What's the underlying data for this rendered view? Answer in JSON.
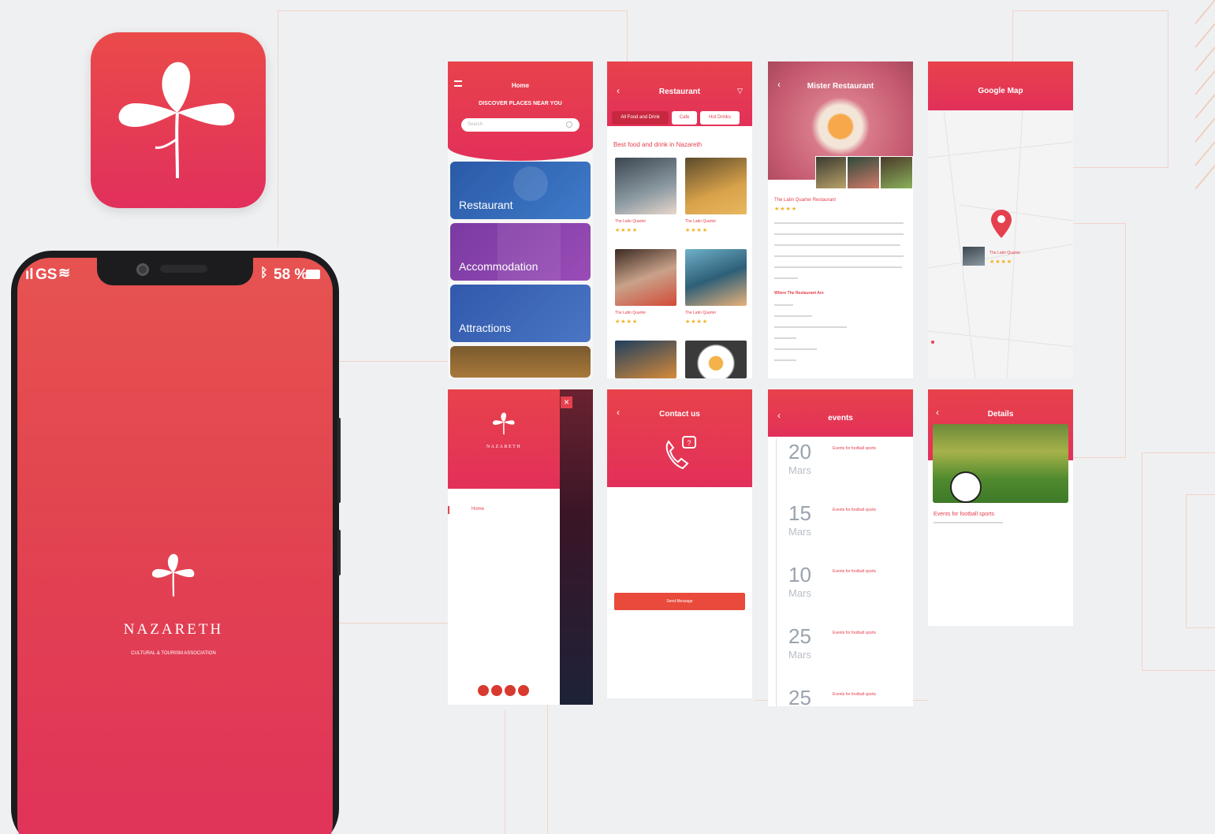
{
  "app_icon": {
    "icon": "iris-flower-icon",
    "colors": {
      "top": "#ea4a4a",
      "bottom": "#e1305c"
    }
  },
  "phone": {
    "status": {
      "carrier": "GS",
      "battery": "58 %"
    },
    "logo": {
      "name": "NAZARETH",
      "subtitle_en": "CULTURAL & TOURISM ASSOCIATION"
    }
  },
  "screens": {
    "home": {
      "title": "Home",
      "headline": "DISCOVER PLACES NEAR YOU",
      "search_placeholder": "Search",
      "categories": [
        {
          "label": "Restaurant",
          "color": "#2f65b5"
        },
        {
          "label": "Accommodation",
          "color": "#8a3ea8"
        },
        {
          "label": "Attractions",
          "color": "#3c63b8"
        },
        {
          "label": "",
          "color": "#9a6a2e"
        }
      ]
    },
    "restaurant": {
      "title": "Restaurant",
      "tabs": [
        "All Food and Drink",
        "Cafe",
        "Hot Drinks"
      ],
      "section_title": "Best food and drink in Nazareth",
      "items": [
        {
          "name": "The Latin Quarter",
          "rating": "★★★★"
        },
        {
          "name": "The Latin Quarter",
          "rating": "★★★★"
        },
        {
          "name": "The Latin Quarter",
          "rating": "★★★★"
        },
        {
          "name": "The Latin Quarter",
          "rating": "★★★★"
        }
      ]
    },
    "detail": {
      "header_title": "Mister Restaurant",
      "name": "The Latin Quarter Restaurant",
      "rating": "★★★★",
      "section": "Where The Restaurant Are"
    },
    "map": {
      "title": "Google Map",
      "place": "The Latin Quarter",
      "rating": "★★★★"
    },
    "menu": {
      "first_item": "Home",
      "social": [
        "facebook-icon",
        "google-plus-icon",
        "youtube-icon",
        "twitter-icon"
      ]
    },
    "contact": {
      "title": "Contact us",
      "send_button": "Send Message"
    },
    "events": {
      "title": "events",
      "list": [
        {
          "day": "20",
          "month": "Mars",
          "title": "Events for football sports"
        },
        {
          "day": "15",
          "month": "Mars",
          "title": "Events for football sports"
        },
        {
          "day": "10",
          "month": "Mars",
          "title": "Events for football sports"
        },
        {
          "day": "25",
          "month": "Mars",
          "title": "Events for football sports"
        },
        {
          "day": "25",
          "month": "",
          "title": "Events for football sports"
        }
      ]
    },
    "details": {
      "title": "Details",
      "event_title": "Events for football sports"
    }
  },
  "colors": {
    "brand_red": "#e5394f",
    "brand_pink": "#e1305c",
    "accent_orange": "#ea4a3b",
    "star": "#f2b01e"
  }
}
